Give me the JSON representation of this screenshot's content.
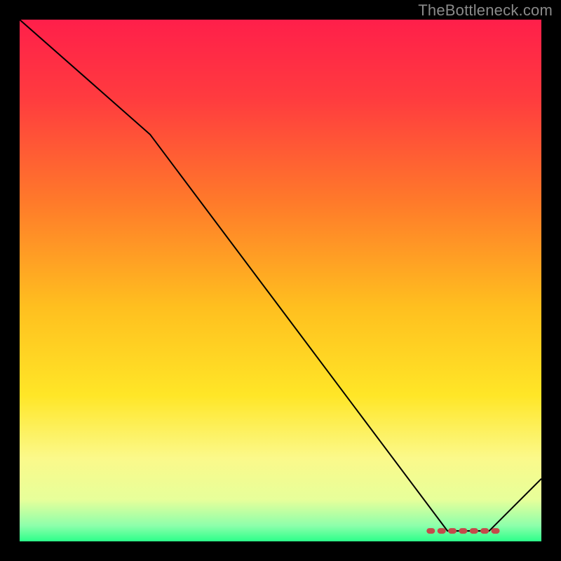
{
  "watermark": "TheBottleneck.com",
  "chart_data": {
    "type": "line",
    "title": "",
    "xlabel": "",
    "ylabel": "",
    "xlim": [
      0,
      100
    ],
    "ylim": [
      0,
      100
    ],
    "grid": false,
    "series": [
      {
        "name": "curve",
        "x": [
          0,
          25,
          82,
          90,
          100
        ],
        "y": [
          100,
          78,
          2,
          2,
          12
        ],
        "color": "#000000",
        "width": 2
      }
    ],
    "marker_band": {
      "name": "marker",
      "x_start": 78,
      "x_end": 92,
      "y": 2,
      "color": "#c44a4a"
    },
    "gradient_stops": [
      {
        "offset": 0.0,
        "color": "#ff1f4a"
      },
      {
        "offset": 0.15,
        "color": "#ff3b3f"
      },
      {
        "offset": 0.35,
        "color": "#ff7a2a"
      },
      {
        "offset": 0.55,
        "color": "#ffbf1f"
      },
      {
        "offset": 0.72,
        "color": "#ffe627"
      },
      {
        "offset": 0.84,
        "color": "#fbf98a"
      },
      {
        "offset": 0.92,
        "color": "#e7ff9a"
      },
      {
        "offset": 0.97,
        "color": "#8dffab"
      },
      {
        "offset": 1.0,
        "color": "#2cff8a"
      }
    ]
  }
}
